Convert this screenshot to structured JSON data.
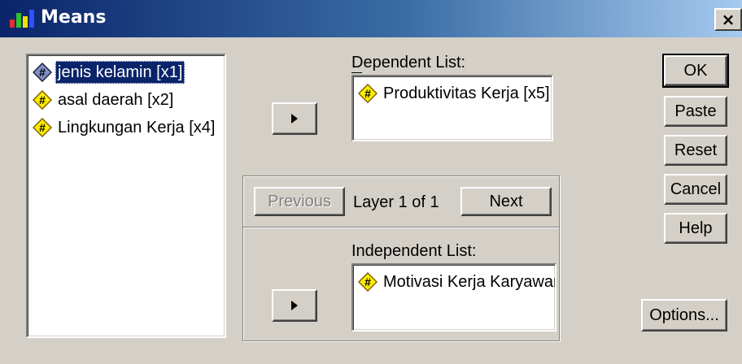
{
  "window": {
    "title": "Means",
    "close_symbol": "×"
  },
  "source_list": {
    "items": [
      {
        "label": "jenis kelamin [x1]",
        "selected": true
      },
      {
        "label": "asal daerah [x2]",
        "selected": false
      },
      {
        "label": "Lingkungan Kerja [x4]",
        "selected": false
      }
    ]
  },
  "dependent": {
    "label": "Dependent List:",
    "items": [
      {
        "label": "Produktivitas Kerja [x5]"
      }
    ]
  },
  "layer": {
    "previous_label": "Previous",
    "status": "Layer 1 of 1",
    "next_label": "Next"
  },
  "independent": {
    "label": "Independent List:",
    "items": [
      {
        "label": "Motivasi Kerja Karyawan"
      }
    ]
  },
  "buttons": {
    "ok": "OK",
    "paste": "Paste",
    "reset": "Reset",
    "cancel": "Cancel",
    "help": "Help",
    "options": "Options..."
  },
  "colors": {
    "titlebar_start": "#0a246a",
    "titlebar_end": "#a6caf0",
    "selection": "#0a246a",
    "face": "#d4d0c8",
    "scale_icon_fill": "#ffee00",
    "nominal_icon_fill": "#8090c0"
  }
}
